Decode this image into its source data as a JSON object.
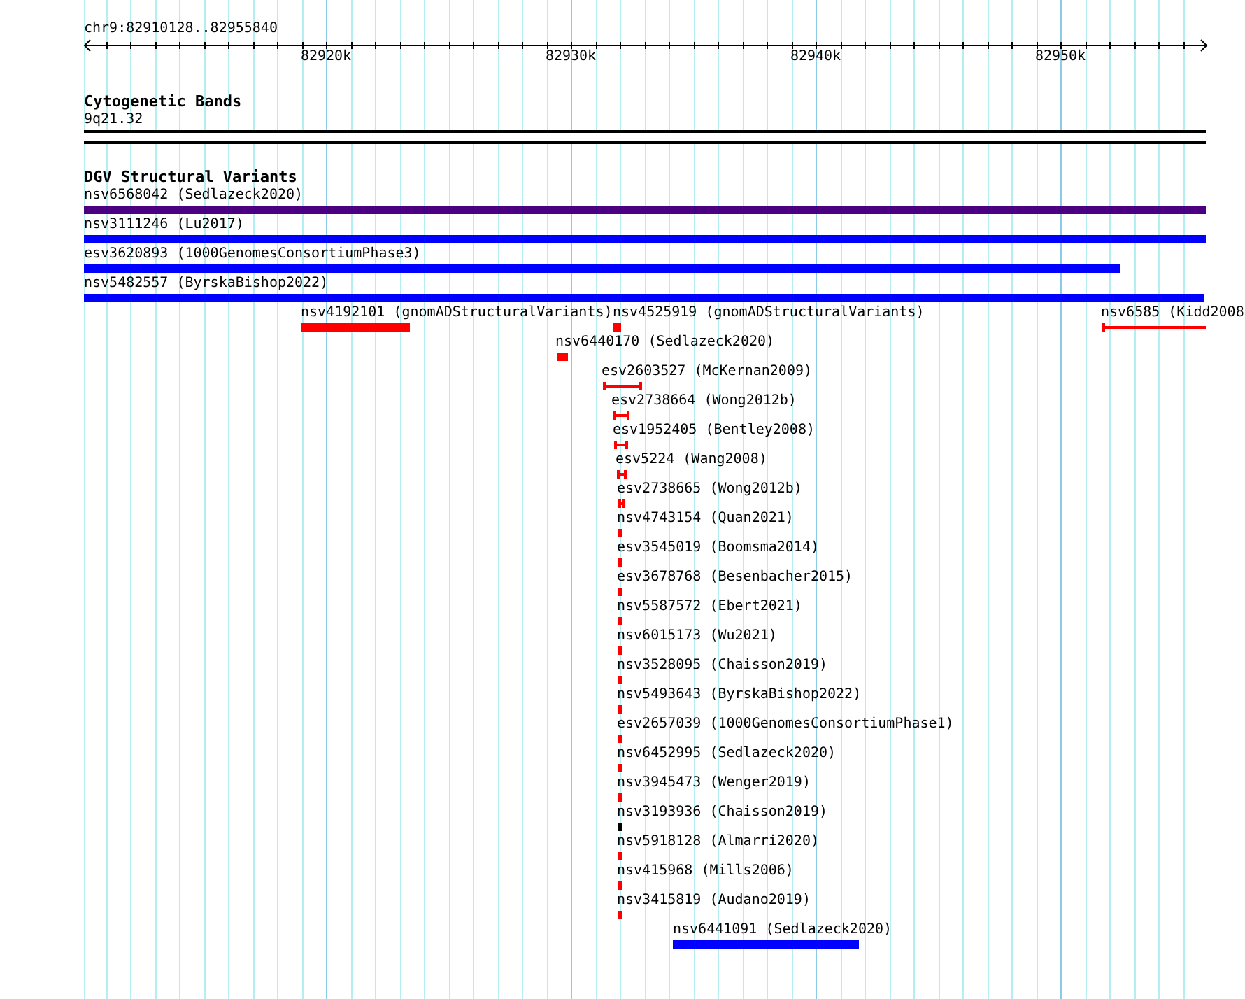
{
  "ruler": {
    "position": "chr9:82910128..82955840",
    "tick_labels": [
      "82920k",
      "82930k",
      "82940k",
      "82950k"
    ]
  },
  "cytogenetic_bands": {
    "title": "Cytogenetic Bands",
    "band": "9q21.32"
  },
  "dgv_track": {
    "title": "DGV Structural Variants",
    "rows": [
      {
        "features": [
          {
            "label": "nsv6568042 (Sedlazeck2020)",
            "kind": "bar",
            "color": "#4b0082"
          }
        ]
      },
      {
        "features": [
          {
            "label": "nsv3111246 (Lu2017)",
            "kind": "bar",
            "color": "#0000ff"
          }
        ]
      },
      {
        "features": [
          {
            "label": "esv3620893 (1000GenomesConsortiumPhase3)",
            "kind": "bar",
            "color": "#0000ff"
          }
        ]
      },
      {
        "features": [
          {
            "label": "nsv5482557 (ByrskaBishop2022)",
            "kind": "bar",
            "color": "#0000ff"
          }
        ]
      },
      {
        "features": [
          {
            "label": "nsv4192101 (gnomADStructuralVariants)",
            "kind": "bar",
            "color": "#ff0000"
          },
          {
            "label": "nsv4525919 (gnomADStructuralVariants)",
            "kind": "bar",
            "color": "#ff0000"
          },
          {
            "label": "nsv6585 (Kidd2008",
            "kind": "interval",
            "color": "#ff0000"
          }
        ]
      },
      {
        "features": [
          {
            "label": "nsv6440170 (Sedlazeck2020)",
            "kind": "bar",
            "color": "#ff0000"
          }
        ]
      },
      {
        "features": [
          {
            "label": "esv2603527 (McKernan2009)",
            "kind": "interval",
            "color": "#ff0000"
          }
        ]
      },
      {
        "features": [
          {
            "label": "esv2738664 (Wong2012b)",
            "kind": "interval",
            "color": "#ff0000"
          }
        ]
      },
      {
        "features": [
          {
            "label": "esv1952405 (Bentley2008)",
            "kind": "interval",
            "color": "#ff0000"
          }
        ]
      },
      {
        "features": [
          {
            "label": "esv5224 (Wang2008)",
            "kind": "interval",
            "color": "#ff0000"
          }
        ]
      },
      {
        "features": [
          {
            "label": "esv2738665 (Wong2012b)",
            "kind": "interval",
            "color": "#ff0000"
          }
        ]
      },
      {
        "features": [
          {
            "label": "nsv4743154 (Quan2021)",
            "kind": "bar",
            "color": "#ff0000"
          }
        ]
      },
      {
        "features": [
          {
            "label": "esv3545019 (Boomsma2014)",
            "kind": "bar",
            "color": "#ff0000"
          }
        ]
      },
      {
        "features": [
          {
            "label": "esv3678768 (Besenbacher2015)",
            "kind": "bar",
            "color": "#ff0000"
          }
        ]
      },
      {
        "features": [
          {
            "label": "nsv5587572 (Ebert2021)",
            "kind": "bar",
            "color": "#ff0000"
          }
        ]
      },
      {
        "features": [
          {
            "label": "nsv6015173 (Wu2021)",
            "kind": "bar",
            "color": "#ff0000"
          }
        ]
      },
      {
        "features": [
          {
            "label": "nsv3528095 (Chaisson2019)",
            "kind": "bar",
            "color": "#ff0000"
          }
        ]
      },
      {
        "features": [
          {
            "label": "nsv5493643 (ByrskaBishop2022)",
            "kind": "bar",
            "color": "#ff0000"
          }
        ]
      },
      {
        "features": [
          {
            "label": "esv2657039 (1000GenomesConsortiumPhase1)",
            "kind": "bar",
            "color": "#ff0000"
          }
        ]
      },
      {
        "features": [
          {
            "label": "nsv6452995 (Sedlazeck2020)",
            "kind": "bar",
            "color": "#ff0000"
          }
        ]
      },
      {
        "features": [
          {
            "label": "nsv3945473 (Wenger2019)",
            "kind": "bar",
            "color": "#ff0000"
          }
        ]
      },
      {
        "features": [
          {
            "label": "nsv3193936 (Chaisson2019)",
            "kind": "bar",
            "color": "#000000"
          }
        ]
      },
      {
        "features": [
          {
            "label": "nsv5918128 (Almarri2020)",
            "kind": "bar",
            "color": "#ff0000"
          }
        ]
      },
      {
        "features": [
          {
            "label": "nsv415968 (Mills2006)",
            "kind": "bar",
            "color": "#ff0000"
          }
        ]
      },
      {
        "features": [
          {
            "label": "nsv3415819 (Audano2019)",
            "kind": "bar",
            "color": "#ff0000"
          }
        ]
      },
      {
        "features": [
          {
            "label": "nsv6441091 (Sedlazeck2020)",
            "kind": "bar",
            "color": "#0000ff"
          }
        ]
      }
    ]
  }
}
